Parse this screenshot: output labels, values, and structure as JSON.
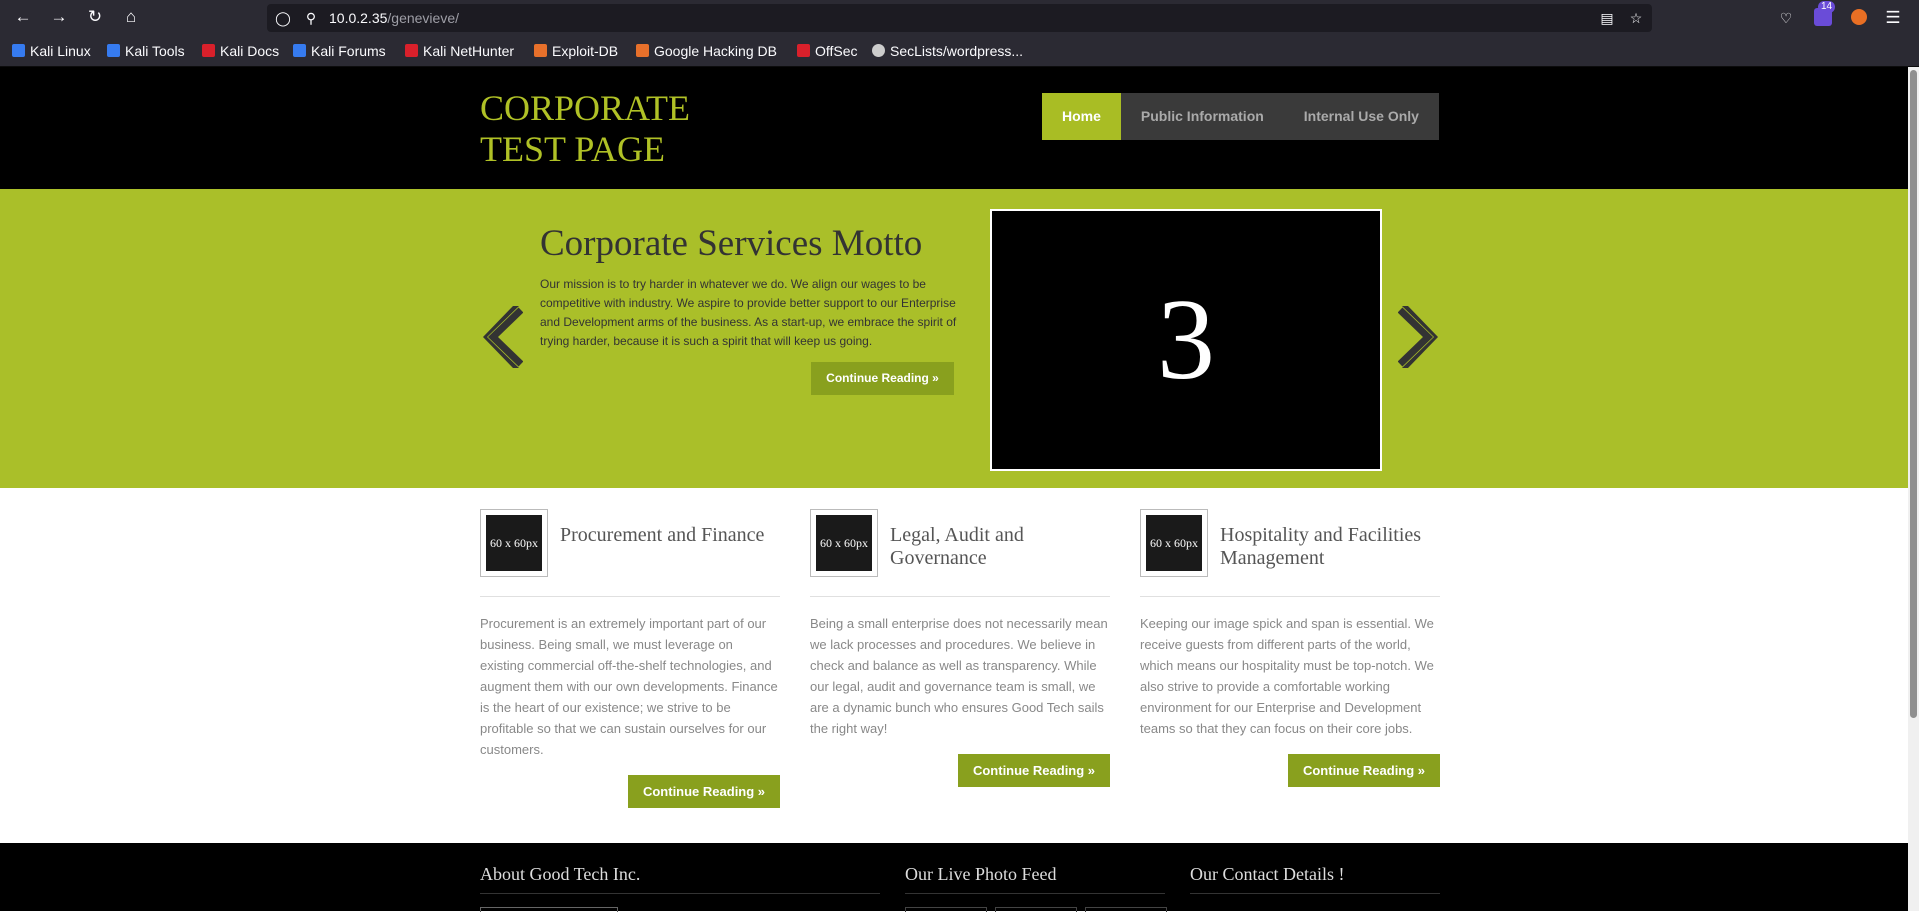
{
  "browser": {
    "url_host": "10.0.2.35",
    "url_path": "/genevieve/",
    "notification_badge": "14",
    "bookmarks": [
      {
        "label": "Kali Linux",
        "color": "#367bf0"
      },
      {
        "label": "Kali Tools",
        "color": "#367bf0"
      },
      {
        "label": "Kali Docs",
        "color": "#d9202b"
      },
      {
        "label": "Kali Forums",
        "color": "#367bf0"
      },
      {
        "label": "Kali NetHunter",
        "color": "#d9202b"
      },
      {
        "label": "Exploit-DB",
        "color": "#e7702b"
      },
      {
        "label": "Google Hacking DB",
        "color": "#e7702b"
      },
      {
        "label": "OffSec",
        "color": "#d9202b"
      },
      {
        "label": "SecLists/wordpress...",
        "color": "#cccccc"
      }
    ]
  },
  "site": {
    "logo_line1": "CORPORATE",
    "logo_line2": "TEST PAGE",
    "nav": [
      "Home",
      "Public Information",
      "Internal Use Only"
    ],
    "active_nav": "Home",
    "accent_color": "#aabf29"
  },
  "hero": {
    "title": "Corporate Services Motto",
    "text": "Our mission is to try harder in whatever we do. We align our wages to be competitive with industry. We aspire to provide better support to our Enterprise and Development arms of the business. As a start-up, we embrace the spirit of trying harder, because it is such a spirit that will keep us going.",
    "button": "Continue Reading »",
    "slide_number": "3"
  },
  "services": [
    {
      "thumb": "60 x 60px",
      "title": "Procurement and Finance",
      "text": "Procurement is an extremely important part of our business. Being small, we must leverage on existing commercial off-the-shelf technologies, and augment them with our own developments. Finance is the heart of our existence; we strive to be profitable so that we can sustain ourselves for our customers.",
      "button": "Continue Reading »"
    },
    {
      "thumb": "60 x 60px",
      "title": "Legal, Audit and Governance",
      "text": "Being a small enterprise does not necessarily mean we lack processes and procedures. We believe in check and balance as well as transparency. While our legal, audit and governance team is small, we are a dynamic bunch who ensures Good Tech sails the right way!",
      "button": "Continue Reading »"
    },
    {
      "thumb": "60 x 60px",
      "title": "Hospitality and Facilities Management",
      "text": "Keeping our image spick and span is essential. We receive guests from different parts of the world, which means our hospitality must be top-notch. We also strive to provide a comfortable working environment for our Enterprise and Development teams so that they can focus on their core jobs.",
      "button": "Continue Reading »"
    }
  ],
  "footer": {
    "titles": [
      "About Good Tech Inc.",
      "Our Live Photo Feed",
      "Our Contact Details !"
    ]
  }
}
